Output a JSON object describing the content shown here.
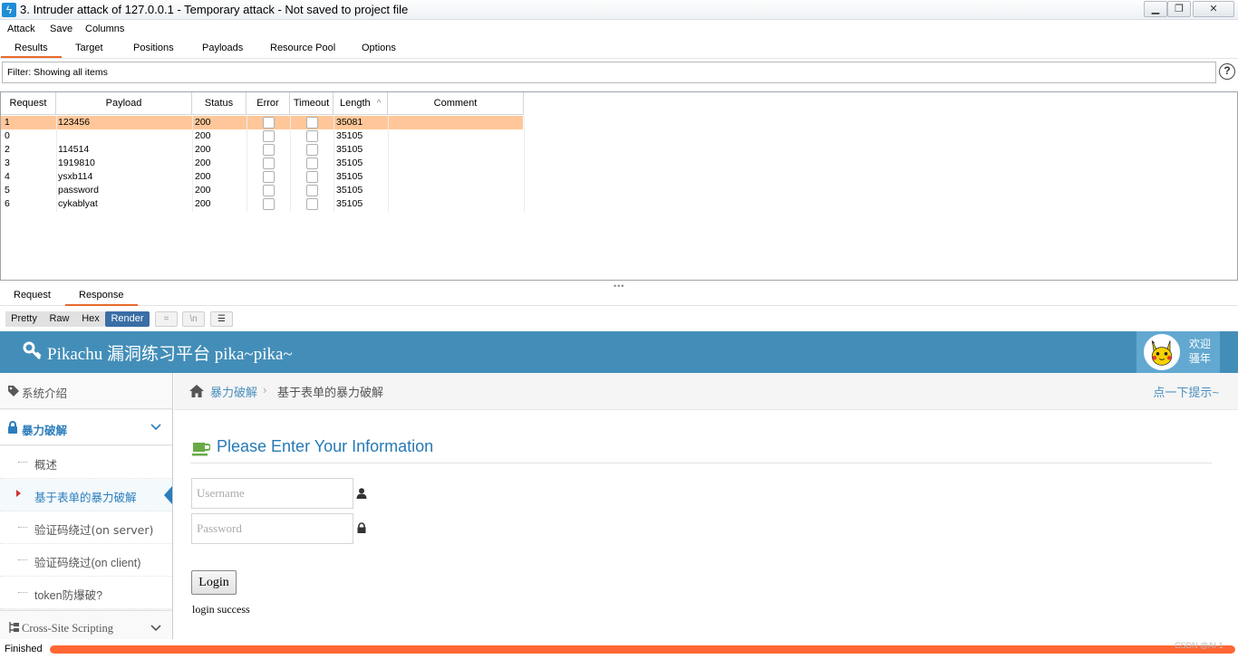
{
  "window": {
    "title": "3. Intruder attack of 127.0.0.1 - Temporary attack - Not saved to project file",
    "min_glyph": "▁",
    "max_glyph": "❐",
    "close_glyph": "✕"
  },
  "menu": [
    "Attack",
    "Save",
    "Columns"
  ],
  "tabs": [
    "Results",
    "Target",
    "Positions",
    "Payloads",
    "Resource Pool",
    "Options"
  ],
  "active_tab": "Results",
  "filter": {
    "text": "Filter: Showing all items"
  },
  "help_glyph": "?",
  "results": {
    "columns": [
      "Request",
      "Payload",
      "Status",
      "Error",
      "Timeout",
      "Length",
      "Comment"
    ],
    "sort_indicator": "^",
    "rows": [
      {
        "request": "1",
        "payload": "123456",
        "status": "200",
        "length": "35081",
        "selected": true
      },
      {
        "request": "0",
        "payload": "",
        "status": "200",
        "length": "35105",
        "selected": false
      },
      {
        "request": "2",
        "payload": "114514",
        "status": "200",
        "length": "35105",
        "selected": false
      },
      {
        "request": "3",
        "payload": "1919810",
        "status": "200",
        "length": "35105",
        "selected": false
      },
      {
        "request": "4",
        "payload": "ysxb114",
        "status": "200",
        "length": "35105",
        "selected": false
      },
      {
        "request": "5",
        "payload": "password",
        "status": "200",
        "length": "35105",
        "selected": false
      },
      {
        "request": "6",
        "payload": "cykablyat",
        "status": "200",
        "length": "35105",
        "selected": false
      }
    ]
  },
  "splitter_glyph": "•••",
  "rr_tabs": [
    "Request",
    "Response"
  ],
  "rr_active": "Response",
  "view_modes": [
    "Pretty",
    "Raw",
    "Hex",
    "Render"
  ],
  "view_active": "Render",
  "view_icons": [
    "=",
    "\\n",
    "☰"
  ],
  "pikachu": {
    "site_title": "Pikachu 漏洞练习平台 pika~pika~",
    "welcome_1": "欢迎",
    "welcome_2": "骚年",
    "sidebar": {
      "intro": "系统介绍",
      "brute": "暴力破解",
      "subitems": [
        "概述",
        "基于表单的暴力破解",
        "验证码绕过(on server)",
        "验证码绕过(on client)",
        "token防爆破?"
      ],
      "active_sub": 1,
      "xss": "Cross-Site Scripting"
    },
    "breadcrumb": {
      "parent": "暴力破解",
      "sep": "›",
      "current": "基于表单的暴力破解",
      "tip": "点一下提示~"
    },
    "form": {
      "heading": "Please Enter Your Information",
      "username_placeholder": "Username",
      "password_placeholder": "Password",
      "login_label": "Login",
      "message": "login success"
    }
  },
  "status": {
    "text": "Finished",
    "progress": 1.0,
    "watermark": "CSDN @AI-1"
  },
  "colors": {
    "accent": "#e8692d",
    "selected_row": "#ffc799",
    "pika_blue": "#438eb9",
    "progress": "#ff6633"
  }
}
